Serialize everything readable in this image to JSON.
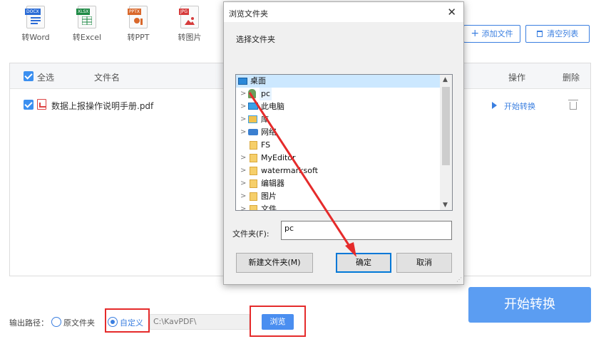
{
  "toolbar": {
    "tools": [
      {
        "label": "转Word",
        "tag": "DOCX",
        "tag_color": "#2b6cd6"
      },
      {
        "label": "转Excel",
        "tag": "XLSX",
        "tag_color": "#1e8a45"
      },
      {
        "label": "转PPT",
        "tag": "PPTX",
        "tag_color": "#d9682b"
      },
      {
        "label": "转图片",
        "tag": "JPG",
        "tag_color": "#d63b3b"
      }
    ],
    "add_file": "添加文件",
    "clear_list": "清空列表"
  },
  "file_list": {
    "select_all": "全选",
    "col_filename": "文件名",
    "col_action": "操作",
    "col_delete": "删除",
    "rows": [
      {
        "filename": "数据上报操作说明手册.pdf",
        "action": "开始转换",
        "checked": true
      }
    ]
  },
  "footer": {
    "output_label": "输出路径：",
    "option_original": "原文件夹",
    "option_custom": "自定义",
    "path_value": "C:\\KavPDF\\",
    "browse": "浏览",
    "start": "开始转换"
  },
  "dialog": {
    "title": "浏览文件夹",
    "close": "✕",
    "subtitle": "选择文件夹",
    "tree": [
      {
        "label": "桌面",
        "selected": true
      },
      {
        "label": "pc",
        "highlighted": true
      },
      {
        "label": "此电脑"
      },
      {
        "label": "库"
      },
      {
        "label": "网络"
      },
      {
        "label": "FS"
      },
      {
        "label": "MyEditor"
      },
      {
        "label": "watermarksoft"
      },
      {
        "label": "编辑器"
      },
      {
        "label": "图片"
      },
      {
        "label": "文件"
      }
    ],
    "folder_label": "文件夹(F):",
    "folder_value": "pc",
    "new_folder": "新建文件夹(M)",
    "ok": "确定",
    "cancel": "取消"
  },
  "colors": {
    "accent": "#3b7fe0",
    "highlight_red": "#e52b2b",
    "start_button": "#5b9df2"
  }
}
